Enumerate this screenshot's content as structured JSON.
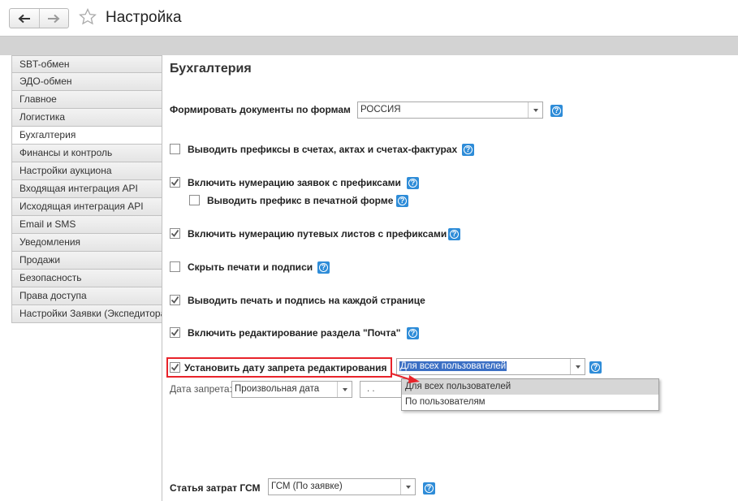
{
  "window": {
    "title": "Настройка",
    "nav": {
      "back_icon": "arrow-left-icon",
      "forward_icon": "arrow-right-icon",
      "favorite_icon": "star-outline-icon"
    }
  },
  "sidebar": {
    "items": [
      {
        "label": "SBT-обмен"
      },
      {
        "label": "ЭДО-обмен"
      },
      {
        "label": "Главное"
      },
      {
        "label": "Логистика"
      },
      {
        "label": "Бухгалтерия",
        "active": true
      },
      {
        "label": "Финансы и контроль"
      },
      {
        "label": "Настройки аукциона"
      },
      {
        "label": "Входящая интеграция API"
      },
      {
        "label": "Исходящая интеграция API"
      },
      {
        "label": "Email и SMS"
      },
      {
        "label": "Уведомления"
      },
      {
        "label": "Продажи"
      },
      {
        "label": "Безопасность"
      },
      {
        "label": "Права доступа"
      },
      {
        "label": "Настройки Заявки (Экспедитора)"
      }
    ]
  },
  "content": {
    "title": "Бухгалтерия",
    "doc_forms": {
      "label": "Формировать документы по формам",
      "value": "РОССИЯ"
    },
    "options": {
      "prefixes_in_docs": {
        "label": "Выводить префиксы в счетах, актах и счетах-фактурах",
        "checked": false
      },
      "order_numbering": {
        "label": "Включить нумерацию заявок с префиксами",
        "checked": true
      },
      "print_prefix": {
        "label": "Выводить префикс в печатной форме",
        "checked": false
      },
      "waybill_numbering": {
        "label": "Включить нумерацию путевых листов с префиксами",
        "checked": true
      },
      "hide_stamps": {
        "label": "Скрыть печати и подписи",
        "checked": false
      },
      "stamp_each_page": {
        "label": "Выводить печать и подпись на каждой странице",
        "checked": true
      },
      "mail_editing": {
        "label": "Включить редактирование раздела \"Почта\"",
        "checked": true
      },
      "edit_ban_date": {
        "label": "Установить дату запрета редактирования",
        "checked": true
      }
    },
    "ban_scope": {
      "value": "Для всех пользователей",
      "options": [
        "Для всех пользователей",
        "По пользователям"
      ]
    },
    "ban_date": {
      "label": "Дата запрета:",
      "mode": "Произвольная дата",
      "date": ". ."
    },
    "fuel_cost": {
      "label": "Статья затрат ГСМ",
      "value": "ГСМ (По заявке)"
    }
  },
  "colors": {
    "accent": "#2e8cd8",
    "highlight_border": "#e8232a",
    "selection": "#3b6fc4",
    "header_band": "#d3d3d3"
  }
}
